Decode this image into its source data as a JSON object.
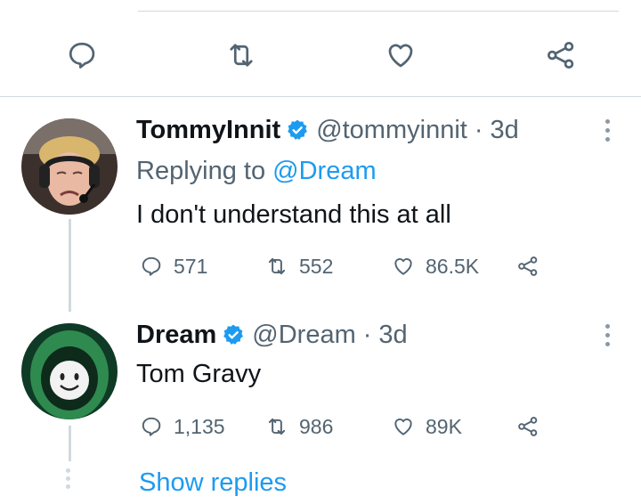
{
  "colors": {
    "accent": "#1d9bf0",
    "secondary_text": "#536471",
    "primary_text": "#0f1419",
    "divider": "#cfd9de"
  },
  "main_tweet_actions": [
    {
      "icon": "reply-icon"
    },
    {
      "icon": "retweet-icon"
    },
    {
      "icon": "like-icon"
    },
    {
      "icon": "share-icon"
    }
  ],
  "tweets": [
    {
      "display_name": "TommyInnit",
      "handle": "@tommyinnit",
      "separator": "·",
      "time": "3d",
      "replying_prefix": "Replying to",
      "replying_to": "@Dream",
      "text": "I don't understand this at all",
      "replies": "571",
      "retweets": "552",
      "likes": "86.5K"
    },
    {
      "display_name": "Dream",
      "handle": "@Dream",
      "separator": "·",
      "time": "3d",
      "text": "Tom Gravy",
      "replies": "1,135",
      "retweets": "986",
      "likes": "89K"
    }
  ],
  "show_replies_label": "Show replies"
}
